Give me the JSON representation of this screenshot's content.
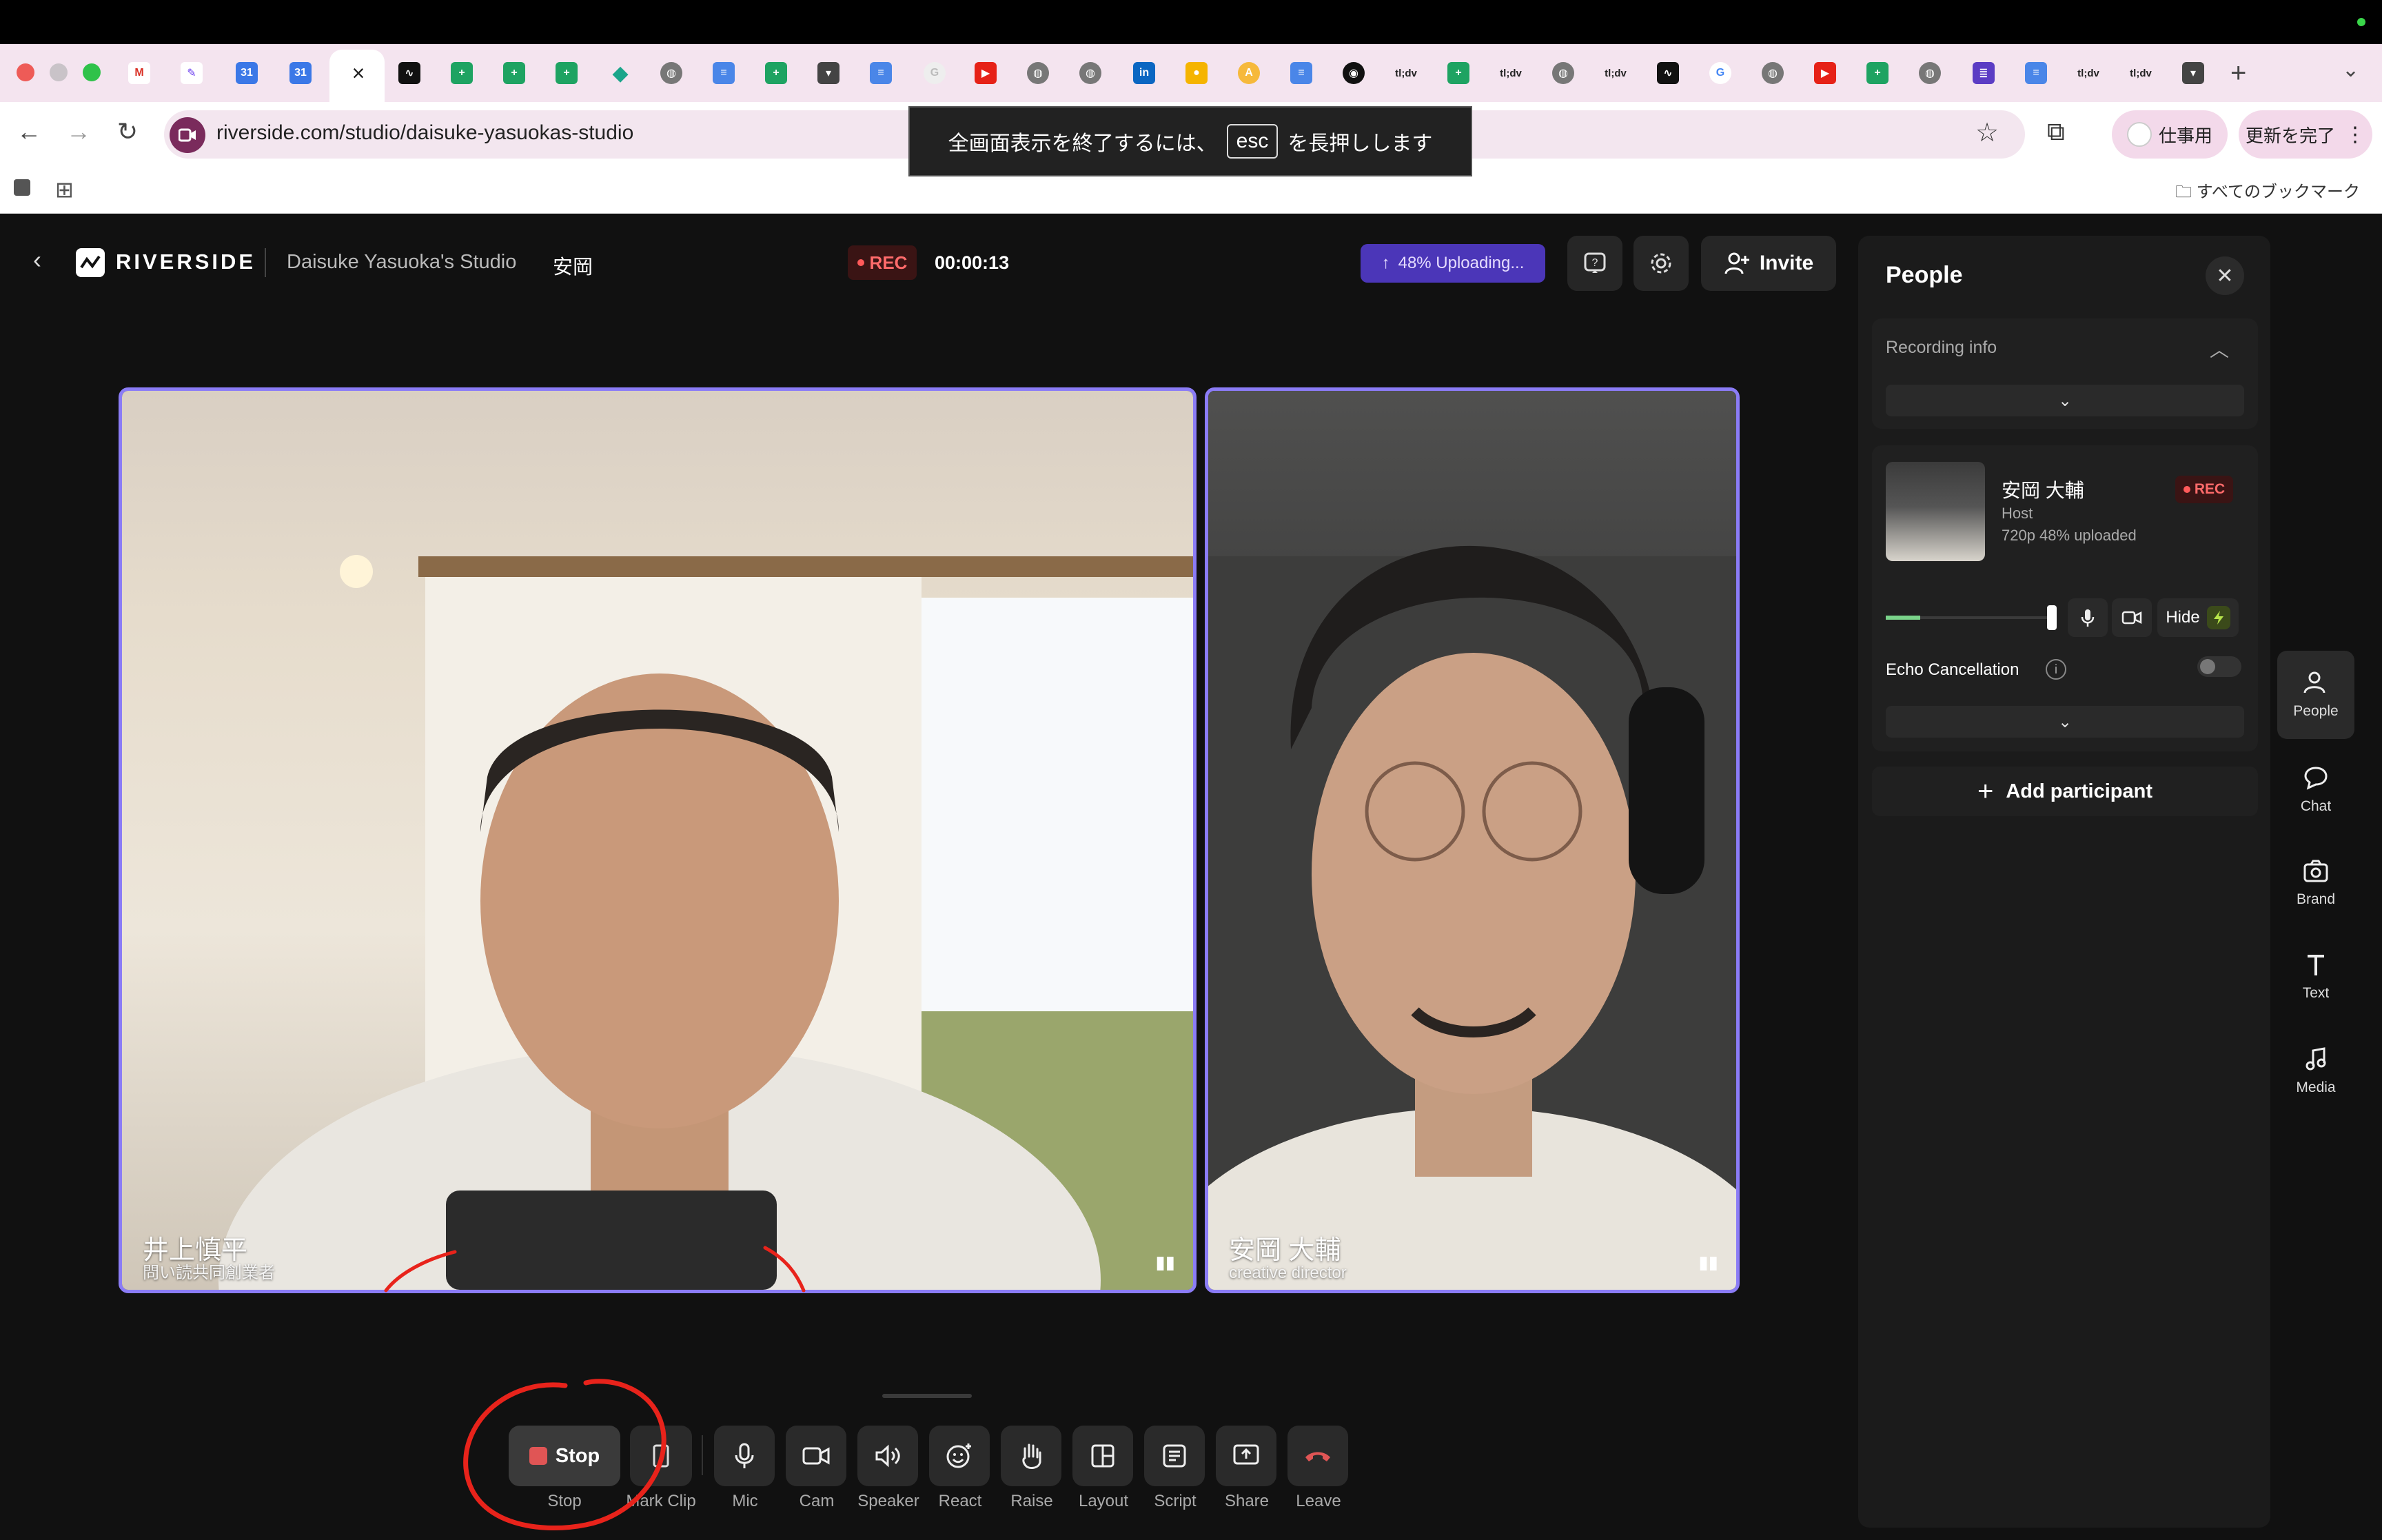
{
  "browser": {
    "url": "riverside.com/studio/daisuke-yasuokas-studio",
    "fullscreen_toast": {
      "before": "全画面表示を終了するには、",
      "key": "esc",
      "after": "を長押しします"
    },
    "profile_label": "仕事用",
    "update_label": "更新を完了",
    "bookmarks_label": "すべてのブックマーク",
    "tab_labels": [
      "tl;dv",
      "tl;dv",
      "tl;dv",
      "tl;dv",
      "tl;dv"
    ]
  },
  "header": {
    "brand": "RIVERSIDE",
    "studio_name": "Daisuke Yasuoka's Studio",
    "user_short": "安岡",
    "rec_label": "REC",
    "timer": "00:00:13",
    "upload_status": "48% Uploading...",
    "invite_label": "Invite"
  },
  "tiles": [
    {
      "name": "井上慎平",
      "role": "問い読共同創業者"
    },
    {
      "name": "安岡 大輔",
      "role": "creative director"
    }
  ],
  "toolbar": [
    {
      "label": "Stop",
      "button_text": "Stop"
    },
    {
      "label": "Mark Clip"
    },
    {
      "label": "Mic"
    },
    {
      "label": "Cam"
    },
    {
      "label": "Speaker"
    },
    {
      "label": "React"
    },
    {
      "label": "Raise"
    },
    {
      "label": "Layout"
    },
    {
      "label": "Script"
    },
    {
      "label": "Share"
    },
    {
      "label": "Leave"
    }
  ],
  "panel": {
    "title": "People",
    "recording_info_label": "Recording info",
    "host": {
      "name": "安岡 大輔",
      "role": "Host",
      "meta": "720p  48% uploaded",
      "rec_label": "REC"
    },
    "hide_label": "Hide",
    "echo_label": "Echo Cancellation",
    "add_participant": "Add participant"
  },
  "rail": [
    {
      "label": "People",
      "icon": "people-icon"
    },
    {
      "label": "Chat",
      "icon": "chat-icon"
    },
    {
      "label": "Brand",
      "icon": "brand-icon"
    },
    {
      "label": "Text",
      "icon": "text-icon"
    },
    {
      "label": "Media",
      "icon": "music-note-icon"
    }
  ],
  "colors": {
    "accent_purple": "#8b7cf6",
    "upload_pill": "#4b36b8",
    "rec_red": "#ff6b6b",
    "leave_red": "#e05555",
    "annotation_red": "#e8231b"
  }
}
